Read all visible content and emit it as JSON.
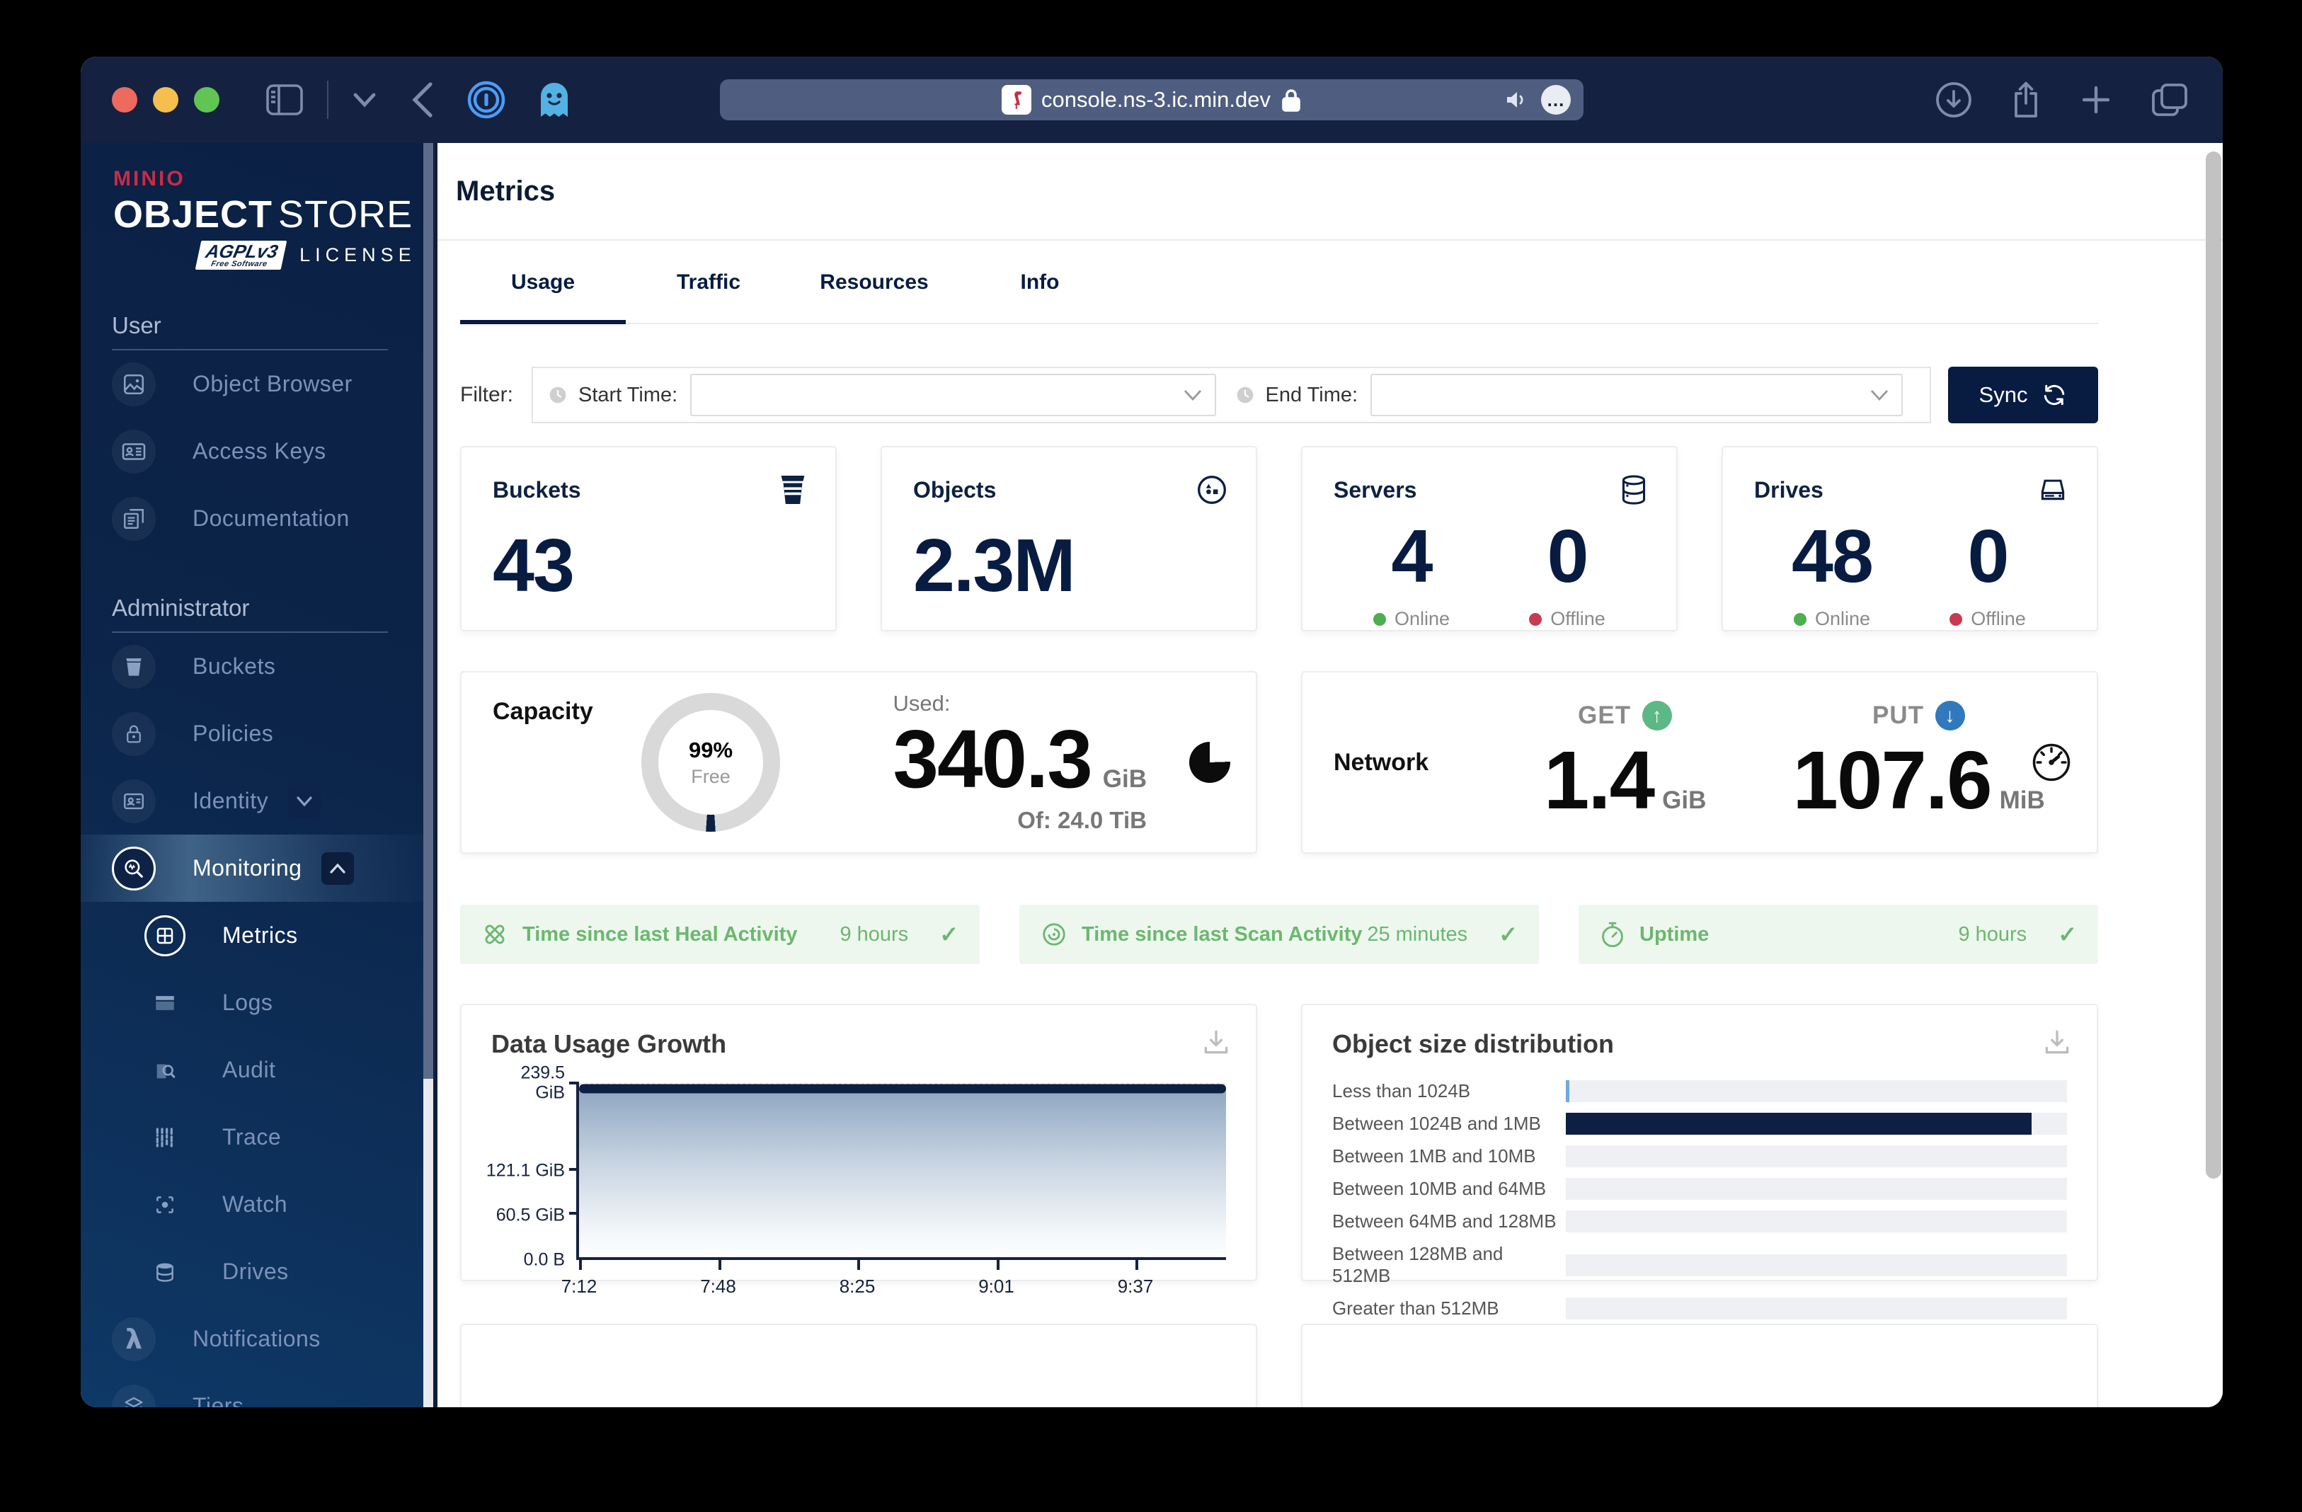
{
  "browser": {
    "url": "console.ns-3.ic.min.dev"
  },
  "sidebar": {
    "logo": {
      "brand": "MINIO",
      "title_bold": "OBJECT",
      "title_light": "STORE",
      "badge_main": "AGPLv3",
      "badge_sub": "Free Software",
      "license": "LICENSE"
    },
    "section_user": "User",
    "section_admin": "Administrator",
    "items": {
      "object_browser": "Object Browser",
      "access_keys": "Access Keys",
      "documentation": "Documentation",
      "buckets": "Buckets",
      "policies": "Policies",
      "identity": "Identity",
      "monitoring": "Monitoring",
      "metrics": "Metrics",
      "logs": "Logs",
      "audit": "Audit",
      "trace": "Trace",
      "watch": "Watch",
      "drives": "Drives",
      "notifications": "Notifications",
      "tiers": "Tiers"
    }
  },
  "main": {
    "title": "Metrics",
    "tabs": [
      {
        "label": "Usage",
        "active": true
      },
      {
        "label": "Traffic",
        "active": false
      },
      {
        "label": "Resources",
        "active": false
      },
      {
        "label": "Info",
        "active": false
      }
    ],
    "filter": {
      "label": "Filter:",
      "start_label": "Start Time:",
      "end_label": "End Time:",
      "start_value": "",
      "end_value": "",
      "sync_label": "Sync"
    },
    "stats": {
      "buckets": {
        "title": "Buckets",
        "value": "43"
      },
      "objects": {
        "title": "Objects",
        "value": "2.3M"
      },
      "servers": {
        "title": "Servers",
        "online": "4",
        "offline": "0",
        "online_label": "Online",
        "offline_label": "Offline"
      },
      "drives": {
        "title": "Drives",
        "online": "48",
        "offline": "0",
        "online_label": "Online",
        "offline_label": "Offline"
      }
    },
    "capacity": {
      "title": "Capacity",
      "donut_pct": "99%",
      "donut_label": "Free",
      "used_label": "Used:",
      "used_value": "340.3",
      "used_unit": "GiB",
      "of_text": "Of: 24.0 TiB"
    },
    "network": {
      "title": "Network",
      "get_label": "GET",
      "get_value": "1.4",
      "get_unit": "GiB",
      "put_label": "PUT",
      "put_value": "107.6",
      "put_unit": "MiB"
    },
    "pills": [
      {
        "label": "Time since last Heal Activity",
        "value": "9 hours"
      },
      {
        "label": "Time since last Scan Activity",
        "value": "25 minutes"
      },
      {
        "label": "Uptime",
        "value": "9 hours"
      }
    ]
  },
  "chart_data": [
    {
      "type": "area",
      "title": "Data Usage Growth",
      "x": [
        "7:12",
        "7:48",
        "8:25",
        "9:01",
        "9:37"
      ],
      "x_fracs": [
        0,
        0.215,
        0.43,
        0.645,
        0.86
      ],
      "series": [
        {
          "name": "Data Usage",
          "values": [
            232,
            232,
            232,
            232,
            232
          ]
        }
      ],
      "yticks": [
        {
          "label": "239.5",
          "label2": "GiB",
          "value": 239.5
        },
        {
          "label": "121.1 GiB",
          "label2": "",
          "value": 121.1
        },
        {
          "label": "60.5 GiB",
          "label2": "",
          "value": 60.5
        },
        {
          "label": "0.0 B",
          "label2": "",
          "value": 0
        }
      ],
      "ymax": 239.5,
      "line_value": 232,
      "grid": "dotted horizontal"
    },
    {
      "type": "bar",
      "title": "Object size distribution",
      "orientation": "horizontal",
      "categories": [
        "Less than 1024B",
        "Between 1024B and 1MB",
        "Between 1MB and 10MB",
        "Between 10MB and 64MB",
        "Between 64MB and 128MB",
        "Between 128MB and 512MB",
        "Greater than 512MB"
      ],
      "values_pct": [
        0.7,
        93,
        0,
        0,
        0,
        0,
        0
      ],
      "bar_colors": [
        "#74a9dc",
        "#0d1f42",
        "#0d1f42",
        "#0d1f42",
        "#0d1f42",
        "#0d1f42",
        "#0d1f42"
      ]
    }
  ],
  "colors": {
    "accent_navy": "#081C42",
    "online_green": "#4caf50",
    "offline_red": "#c73a52",
    "status_green": "#6cb76f",
    "status_bg": "#edf7ee",
    "get_green": "#5cb885",
    "put_blue": "#3079bd",
    "bar_blue": "#74a9dc"
  }
}
